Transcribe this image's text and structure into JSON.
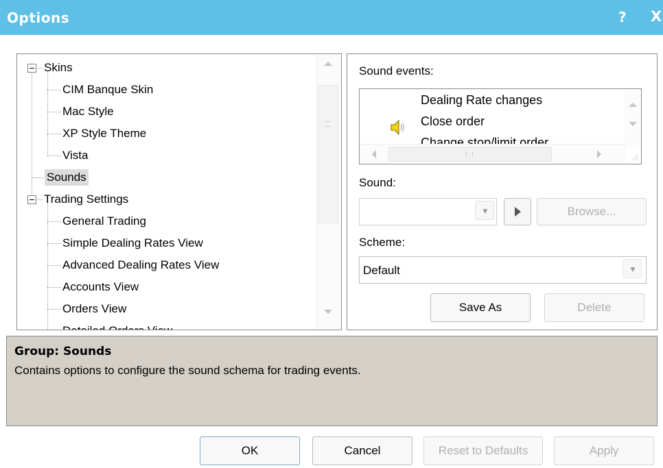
{
  "window": {
    "title": "Options",
    "help_label": "?",
    "close_label": "X"
  },
  "tree": {
    "items": [
      {
        "label": "Skins"
      },
      {
        "label": "CIM Banque Skin"
      },
      {
        "label": "Mac Style"
      },
      {
        "label": "XP Style Theme"
      },
      {
        "label": "Vista"
      },
      {
        "label": "Sounds"
      },
      {
        "label": "Trading Settings"
      },
      {
        "label": "General Trading"
      },
      {
        "label": "Simple Dealing Rates View"
      },
      {
        "label": "Advanced Dealing Rates View"
      },
      {
        "label": "Accounts View"
      },
      {
        "label": "Orders View"
      },
      {
        "label": "Detailed Orders View"
      }
    ],
    "selected_item": "Sounds"
  },
  "sounds": {
    "events_label": "Sound events:",
    "events": [
      "Dealing Rate changes",
      "Close order",
      "Change stop/limit order"
    ],
    "selected_event": "Close order",
    "sound_label": "Sound:",
    "sound_value": "",
    "browse_label": "Browse...",
    "scheme_label": "Scheme:",
    "scheme_value": "Default",
    "save_as_label": "Save As",
    "delete_label": "Delete"
  },
  "group": {
    "heading": "Group: Sounds",
    "description": "Contains options to configure the sound schema for trading events."
  },
  "footer": {
    "ok_label": "OK",
    "cancel_label": "Cancel",
    "reset_label": "Reset to Defaults",
    "apply_label": "Apply"
  },
  "colors": {
    "title_bar": "#5ec0e6",
    "group_panel": "#d4d0c8",
    "selected_item": "#dcdcdc"
  }
}
